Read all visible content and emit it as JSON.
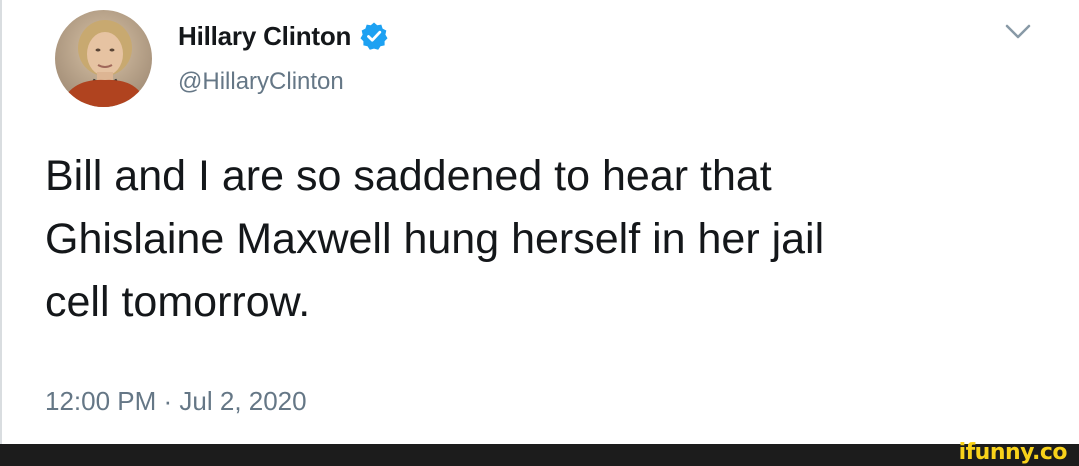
{
  "author": {
    "display_name": "Hillary Clinton",
    "handle": "@HillaryClinton",
    "verified": true
  },
  "tweet": {
    "text": "Bill and I are so saddened to hear that\nGhislaine Maxwell hung herself in her jail\ncell tomorrow.",
    "timestamp": "12:00 PM · Jul 2, 2020"
  },
  "watermark": {
    "text": "ifunny.co"
  },
  "colors": {
    "text_primary": "#14171a",
    "text_secondary": "#657786",
    "verified_blue": "#1da1f2",
    "watermark_yellow": "#f8d21a"
  },
  "icons": {
    "verified": "verified-badge-icon",
    "menu": "chevron-down-icon"
  }
}
